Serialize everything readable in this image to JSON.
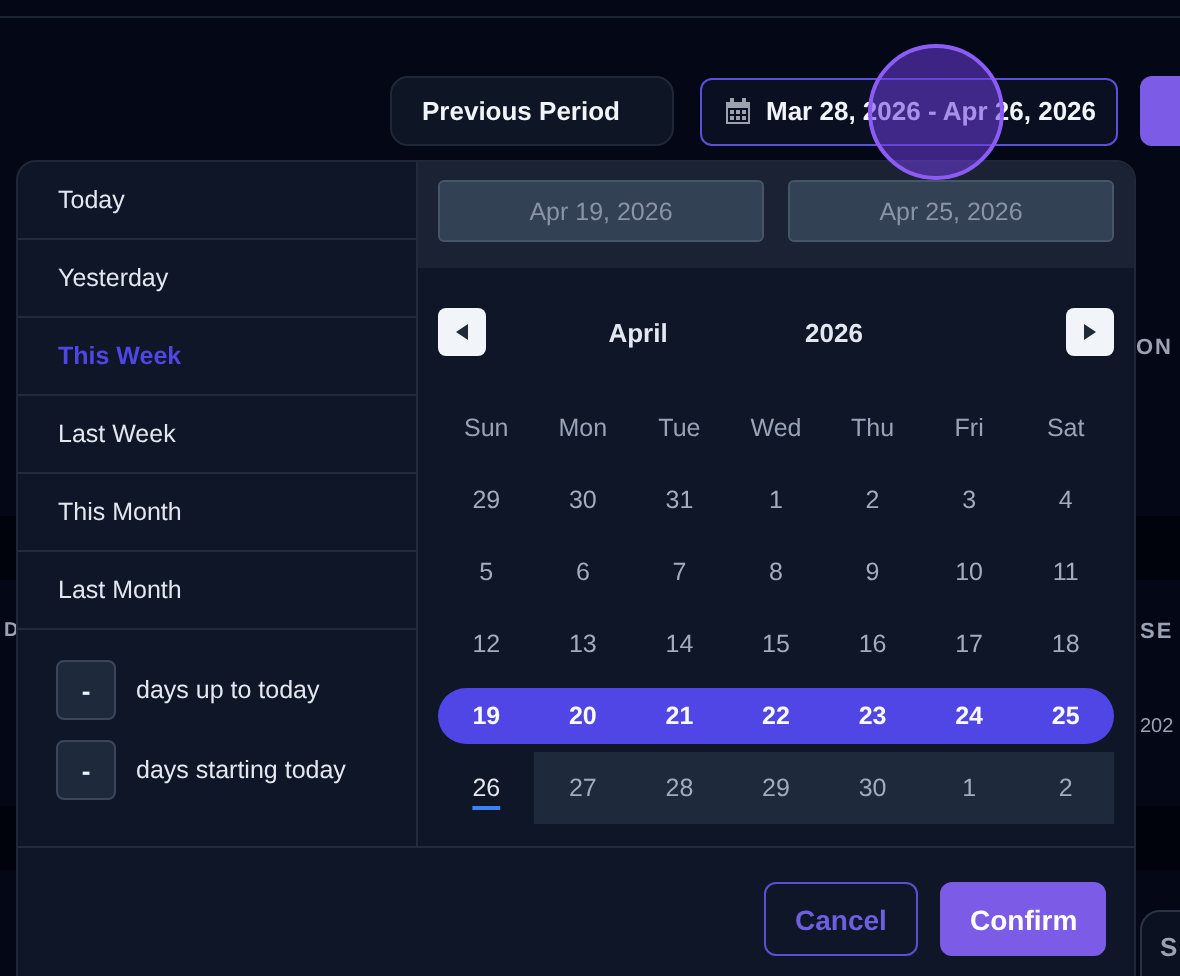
{
  "toolbar": {
    "compare_select": {
      "value": "Previous Period"
    },
    "date_range": {
      "value": "Mar 28, 2026 - Apr 26, 2026"
    }
  },
  "background_fragments": [
    "ON",
    "D",
    "SE",
    "202",
    "S"
  ],
  "picker": {
    "presets": [
      {
        "label": "Today",
        "selected": false
      },
      {
        "label": "Yesterday",
        "selected": false
      },
      {
        "label": "This Week",
        "selected": true
      },
      {
        "label": "Last Week",
        "selected": false
      },
      {
        "label": "This Month",
        "selected": false
      },
      {
        "label": "Last Month",
        "selected": false
      }
    ],
    "relative_days": [
      {
        "value": "-",
        "label": "days up to today"
      },
      {
        "value": "-",
        "label": "days starting today"
      }
    ],
    "start_input": {
      "placeholder": "Apr 19, 2026"
    },
    "end_input": {
      "placeholder": "Apr 25, 2026"
    },
    "month": "April",
    "year": "2026",
    "weekdays": [
      "Sun",
      "Mon",
      "Tue",
      "Wed",
      "Thu",
      "Fri",
      "Sat"
    ],
    "days": [
      {
        "label": "29",
        "selected": false,
        "today": false,
        "shaded": false
      },
      {
        "label": "30",
        "selected": false,
        "today": false,
        "shaded": false
      },
      {
        "label": "31",
        "selected": false,
        "today": false,
        "shaded": false
      },
      {
        "label": "1",
        "selected": false,
        "today": false,
        "shaded": false
      },
      {
        "label": "2",
        "selected": false,
        "today": false,
        "shaded": false
      },
      {
        "label": "3",
        "selected": false,
        "today": false,
        "shaded": false
      },
      {
        "label": "4",
        "selected": false,
        "today": false,
        "shaded": false
      },
      {
        "label": "5",
        "selected": false,
        "today": false,
        "shaded": false
      },
      {
        "label": "6",
        "selected": false,
        "today": false,
        "shaded": false
      },
      {
        "label": "7",
        "selected": false,
        "today": false,
        "shaded": false
      },
      {
        "label": "8",
        "selected": false,
        "today": false,
        "shaded": false
      },
      {
        "label": "9",
        "selected": false,
        "today": false,
        "shaded": false
      },
      {
        "label": "10",
        "selected": false,
        "today": false,
        "shaded": false
      },
      {
        "label": "11",
        "selected": false,
        "today": false,
        "shaded": false
      },
      {
        "label": "12",
        "selected": false,
        "today": false,
        "shaded": false
      },
      {
        "label": "13",
        "selected": false,
        "today": false,
        "shaded": false
      },
      {
        "label": "14",
        "selected": false,
        "today": false,
        "shaded": false
      },
      {
        "label": "15",
        "selected": false,
        "today": false,
        "shaded": false
      },
      {
        "label": "16",
        "selected": false,
        "today": false,
        "shaded": false
      },
      {
        "label": "17",
        "selected": false,
        "today": false,
        "shaded": false
      },
      {
        "label": "18",
        "selected": false,
        "today": false,
        "shaded": false
      },
      {
        "label": "19",
        "selected": true,
        "today": false,
        "shaded": false
      },
      {
        "label": "20",
        "selected": true,
        "today": false,
        "shaded": false
      },
      {
        "label": "21",
        "selected": true,
        "today": false,
        "shaded": false
      },
      {
        "label": "22",
        "selected": true,
        "today": false,
        "shaded": false
      },
      {
        "label": "23",
        "selected": true,
        "today": false,
        "shaded": false
      },
      {
        "label": "24",
        "selected": true,
        "today": false,
        "shaded": false
      },
      {
        "label": "25",
        "selected": true,
        "today": false,
        "shaded": false
      },
      {
        "label": "26",
        "selected": false,
        "today": true,
        "shaded": false
      },
      {
        "label": "27",
        "selected": false,
        "today": false,
        "shaded": true
      },
      {
        "label": "28",
        "selected": false,
        "today": false,
        "shaded": true
      },
      {
        "label": "29",
        "selected": false,
        "today": false,
        "shaded": true
      },
      {
        "label": "30",
        "selected": false,
        "today": false,
        "shaded": true
      },
      {
        "label": "1",
        "selected": false,
        "today": false,
        "shaded": true
      },
      {
        "label": "2",
        "selected": false,
        "today": false,
        "shaded": true
      }
    ],
    "buttons": [
      {
        "label": "Cancel",
        "kind": "secondary"
      },
      {
        "label": "Confirm",
        "kind": "primary"
      }
    ]
  }
}
